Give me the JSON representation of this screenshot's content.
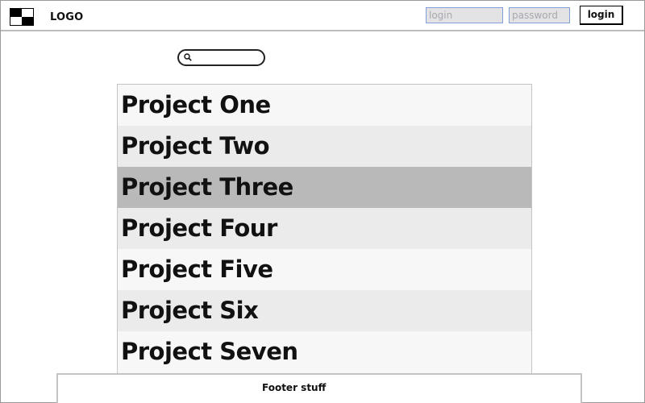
{
  "header": {
    "logo_text": "LOGO",
    "login_placeholder": "login",
    "password_placeholder": "password",
    "login_button_label": "login"
  },
  "search": {
    "placeholder": "",
    "value": ""
  },
  "projects": [
    {
      "label": "Project One",
      "selected": false
    },
    {
      "label": "Project Two",
      "selected": false
    },
    {
      "label": "Project Three",
      "selected": true
    },
    {
      "label": "Project Four",
      "selected": false
    },
    {
      "label": "Project Five",
      "selected": false
    },
    {
      "label": "Project Six",
      "selected": false
    },
    {
      "label": "Project Seven",
      "selected": false
    }
  ],
  "footer": {
    "text": "Footer stuff"
  },
  "colors": {
    "selected_row": "#b9b9b9",
    "alt_row": "#ebebeb",
    "row": "#f7f7f7",
    "input_border": "#7f9fd6",
    "input_bg": "#e3e3e6"
  },
  "icons": {
    "logo": "logo-icon",
    "search": "search-icon"
  }
}
